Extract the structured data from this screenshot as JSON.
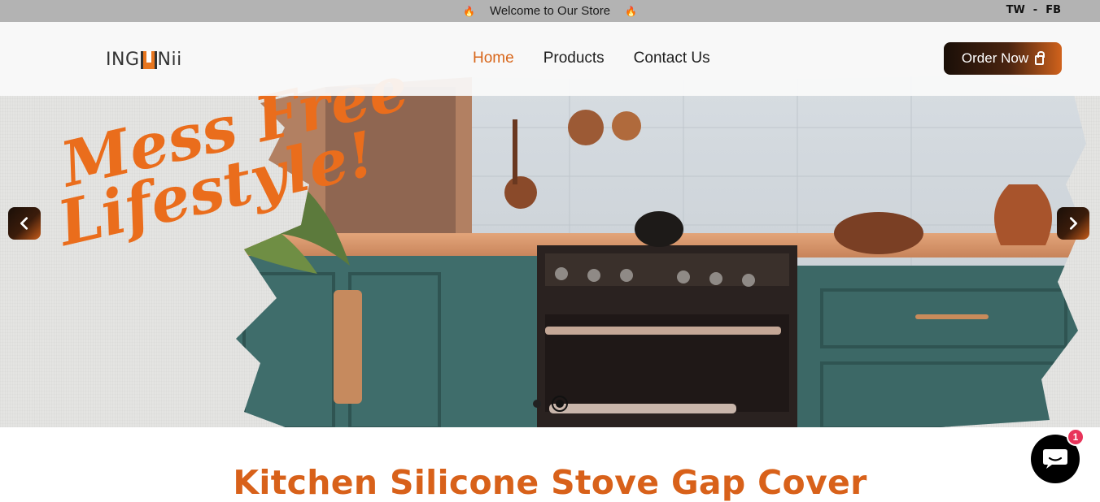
{
  "announcement": {
    "text": "Welcome to Our Store",
    "icon_left": "fire-icon",
    "icon_right": "fire-icon",
    "social": {
      "tw": "TW",
      "separator": "-",
      "fb": "FB"
    }
  },
  "header": {
    "logo_text_left": "ING",
    "logo_text_right": "Nii",
    "nav": [
      {
        "label": "Home",
        "active": true
      },
      {
        "label": "Products",
        "active": false
      },
      {
        "label": "Contact Us",
        "active": false
      }
    ],
    "order_button": "Order Now",
    "order_icon": "shopping-bag-icon"
  },
  "hero": {
    "headline_line1": "Mess Free",
    "headline_line2": "Lifestyle!",
    "prev_icon": "chevron-left-icon",
    "next_icon": "chevron-right-icon",
    "slides_total": 2,
    "active_slide": 2
  },
  "product": {
    "title": "Kitchen Silicone Stove Gap Cover"
  },
  "chat": {
    "icon": "chat-bubble-icon",
    "badge_count": "1"
  },
  "colors": {
    "accent": "#d8661a",
    "topbar": "#b3b3b3",
    "badge": "#e8345a"
  }
}
